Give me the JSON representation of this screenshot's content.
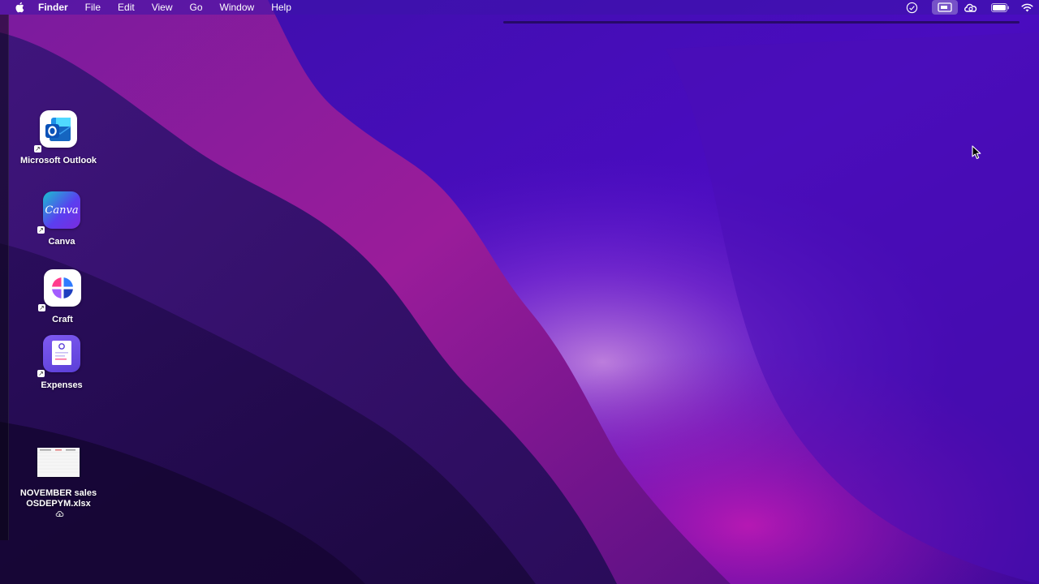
{
  "menubar": {
    "apple_icon": "apple-icon",
    "app_name": "Finder",
    "items": [
      "File",
      "Edit",
      "View",
      "Go",
      "Window",
      "Help"
    ],
    "status_icons": [
      "sync-icon",
      "screen-share-icon",
      "creative-cloud-icon",
      "battery-icon",
      "wifi-icon"
    ]
  },
  "desktop": {
    "icons": [
      {
        "label": "Microsoft Outlook",
        "icon": "outlook-app-icon"
      },
      {
        "label": "Canva",
        "icon": "canva-app-icon",
        "logo_text": "Canva"
      },
      {
        "label": "Craft",
        "icon": "craft-app-icon"
      },
      {
        "label": "Expenses",
        "icon": "expenses-app-icon"
      },
      {
        "label": "NOVEMBER sales OSDEPYM.xlsx",
        "icon": "xlsx-file-icon",
        "badge": "icloud-icon"
      }
    ]
  },
  "colors": {
    "wallpaper_base": "#3a0aa8",
    "wallpaper_dark": "#1f0a4f",
    "wallpaper_magenta": "#b01fa8",
    "wallpaper_glow": "#c07ad8"
  }
}
